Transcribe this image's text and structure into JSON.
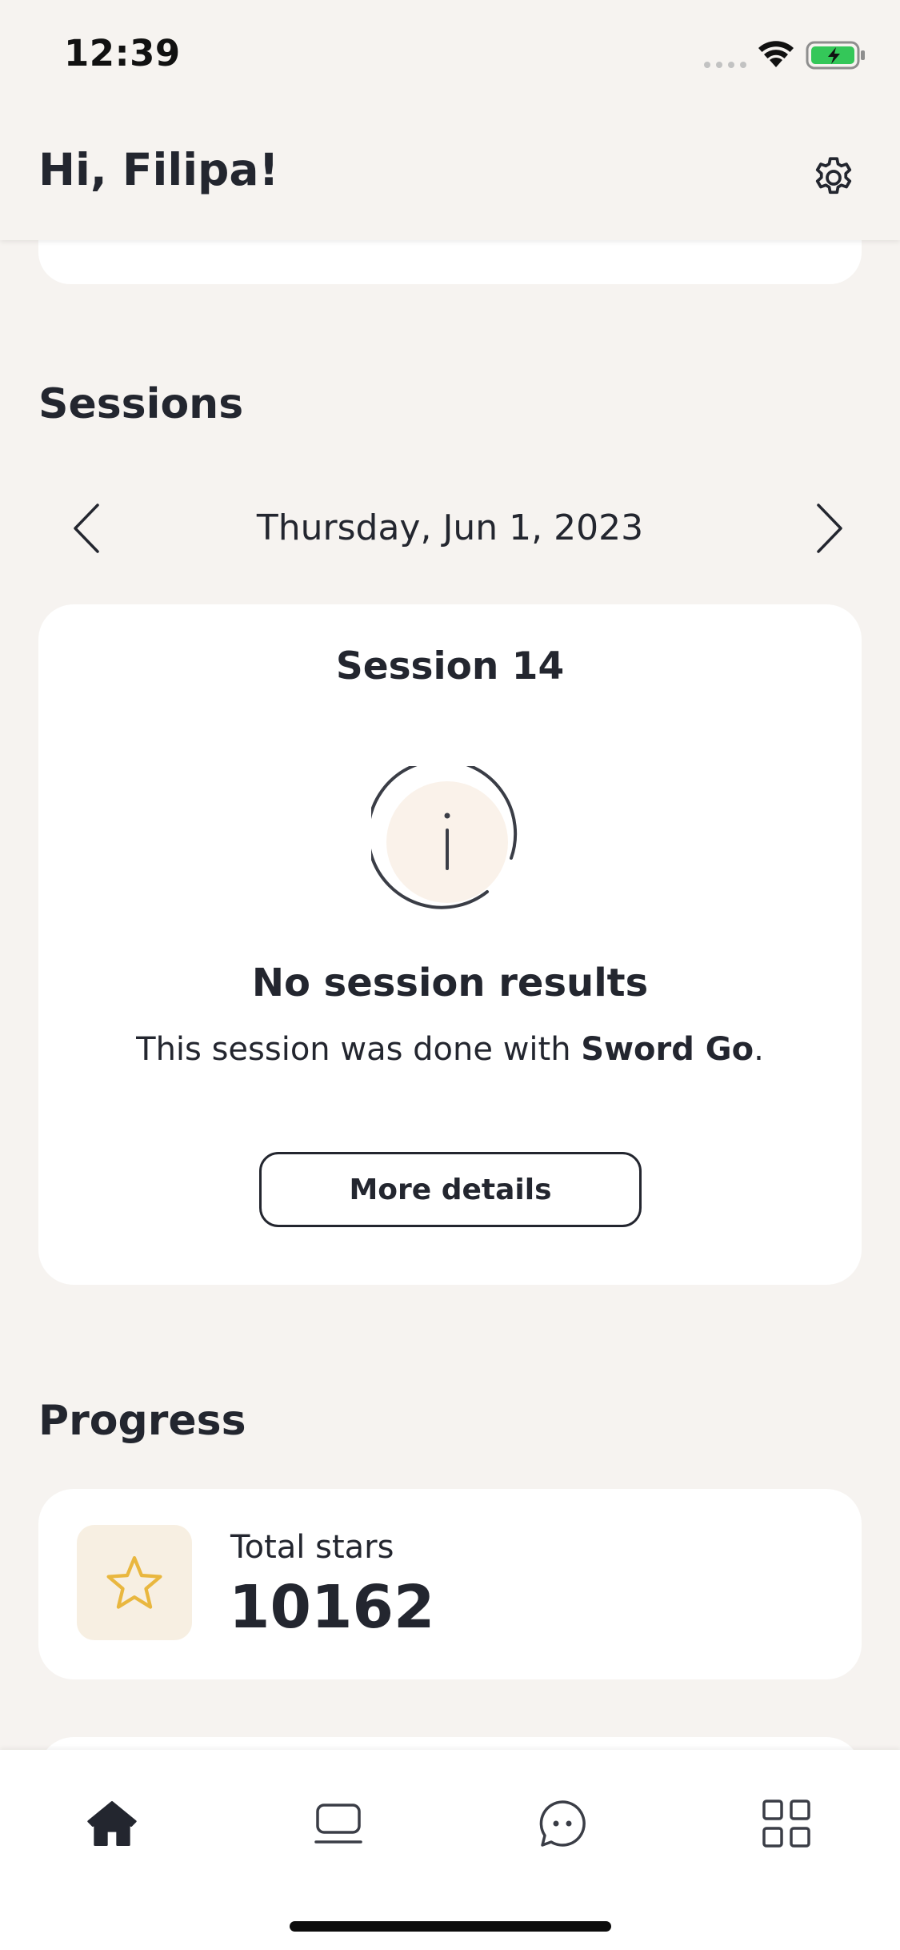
{
  "status_bar": {
    "time": "12:39"
  },
  "header": {
    "greeting": "Hi, Filipa!",
    "settings_icon": "gear-icon"
  },
  "sessions": {
    "title": "Sessions",
    "date": "Thursday, Jun 1, 2023",
    "prev_icon": "chevron-left-icon",
    "next_icon": "chevron-right-icon",
    "card": {
      "title": "Session 14",
      "status_icon": "info-icon",
      "empty_title": "No session results",
      "desc_prefix": "This session was done with ",
      "desc_bold": "Sword Go",
      "desc_suffix": ".",
      "button_label": "More details"
    }
  },
  "progress": {
    "title": "Progress",
    "total_stars_label": "Total stars",
    "total_stars_value": "10162",
    "star_icon": "star-icon",
    "star_color": "#e9b73f",
    "star_bg": "#f7efe2"
  },
  "tabbar": {
    "items": [
      {
        "name": "home",
        "icon": "home-icon",
        "active": true
      },
      {
        "name": "device",
        "icon": "device-icon",
        "active": false
      },
      {
        "name": "chat",
        "icon": "chat-icon",
        "active": false
      },
      {
        "name": "more",
        "icon": "grid-icon",
        "active": false
      }
    ]
  },
  "colors": {
    "background": "#f6f3f0",
    "text": "#23262f",
    "card": "#ffffff",
    "battery_green": "#34c759"
  }
}
